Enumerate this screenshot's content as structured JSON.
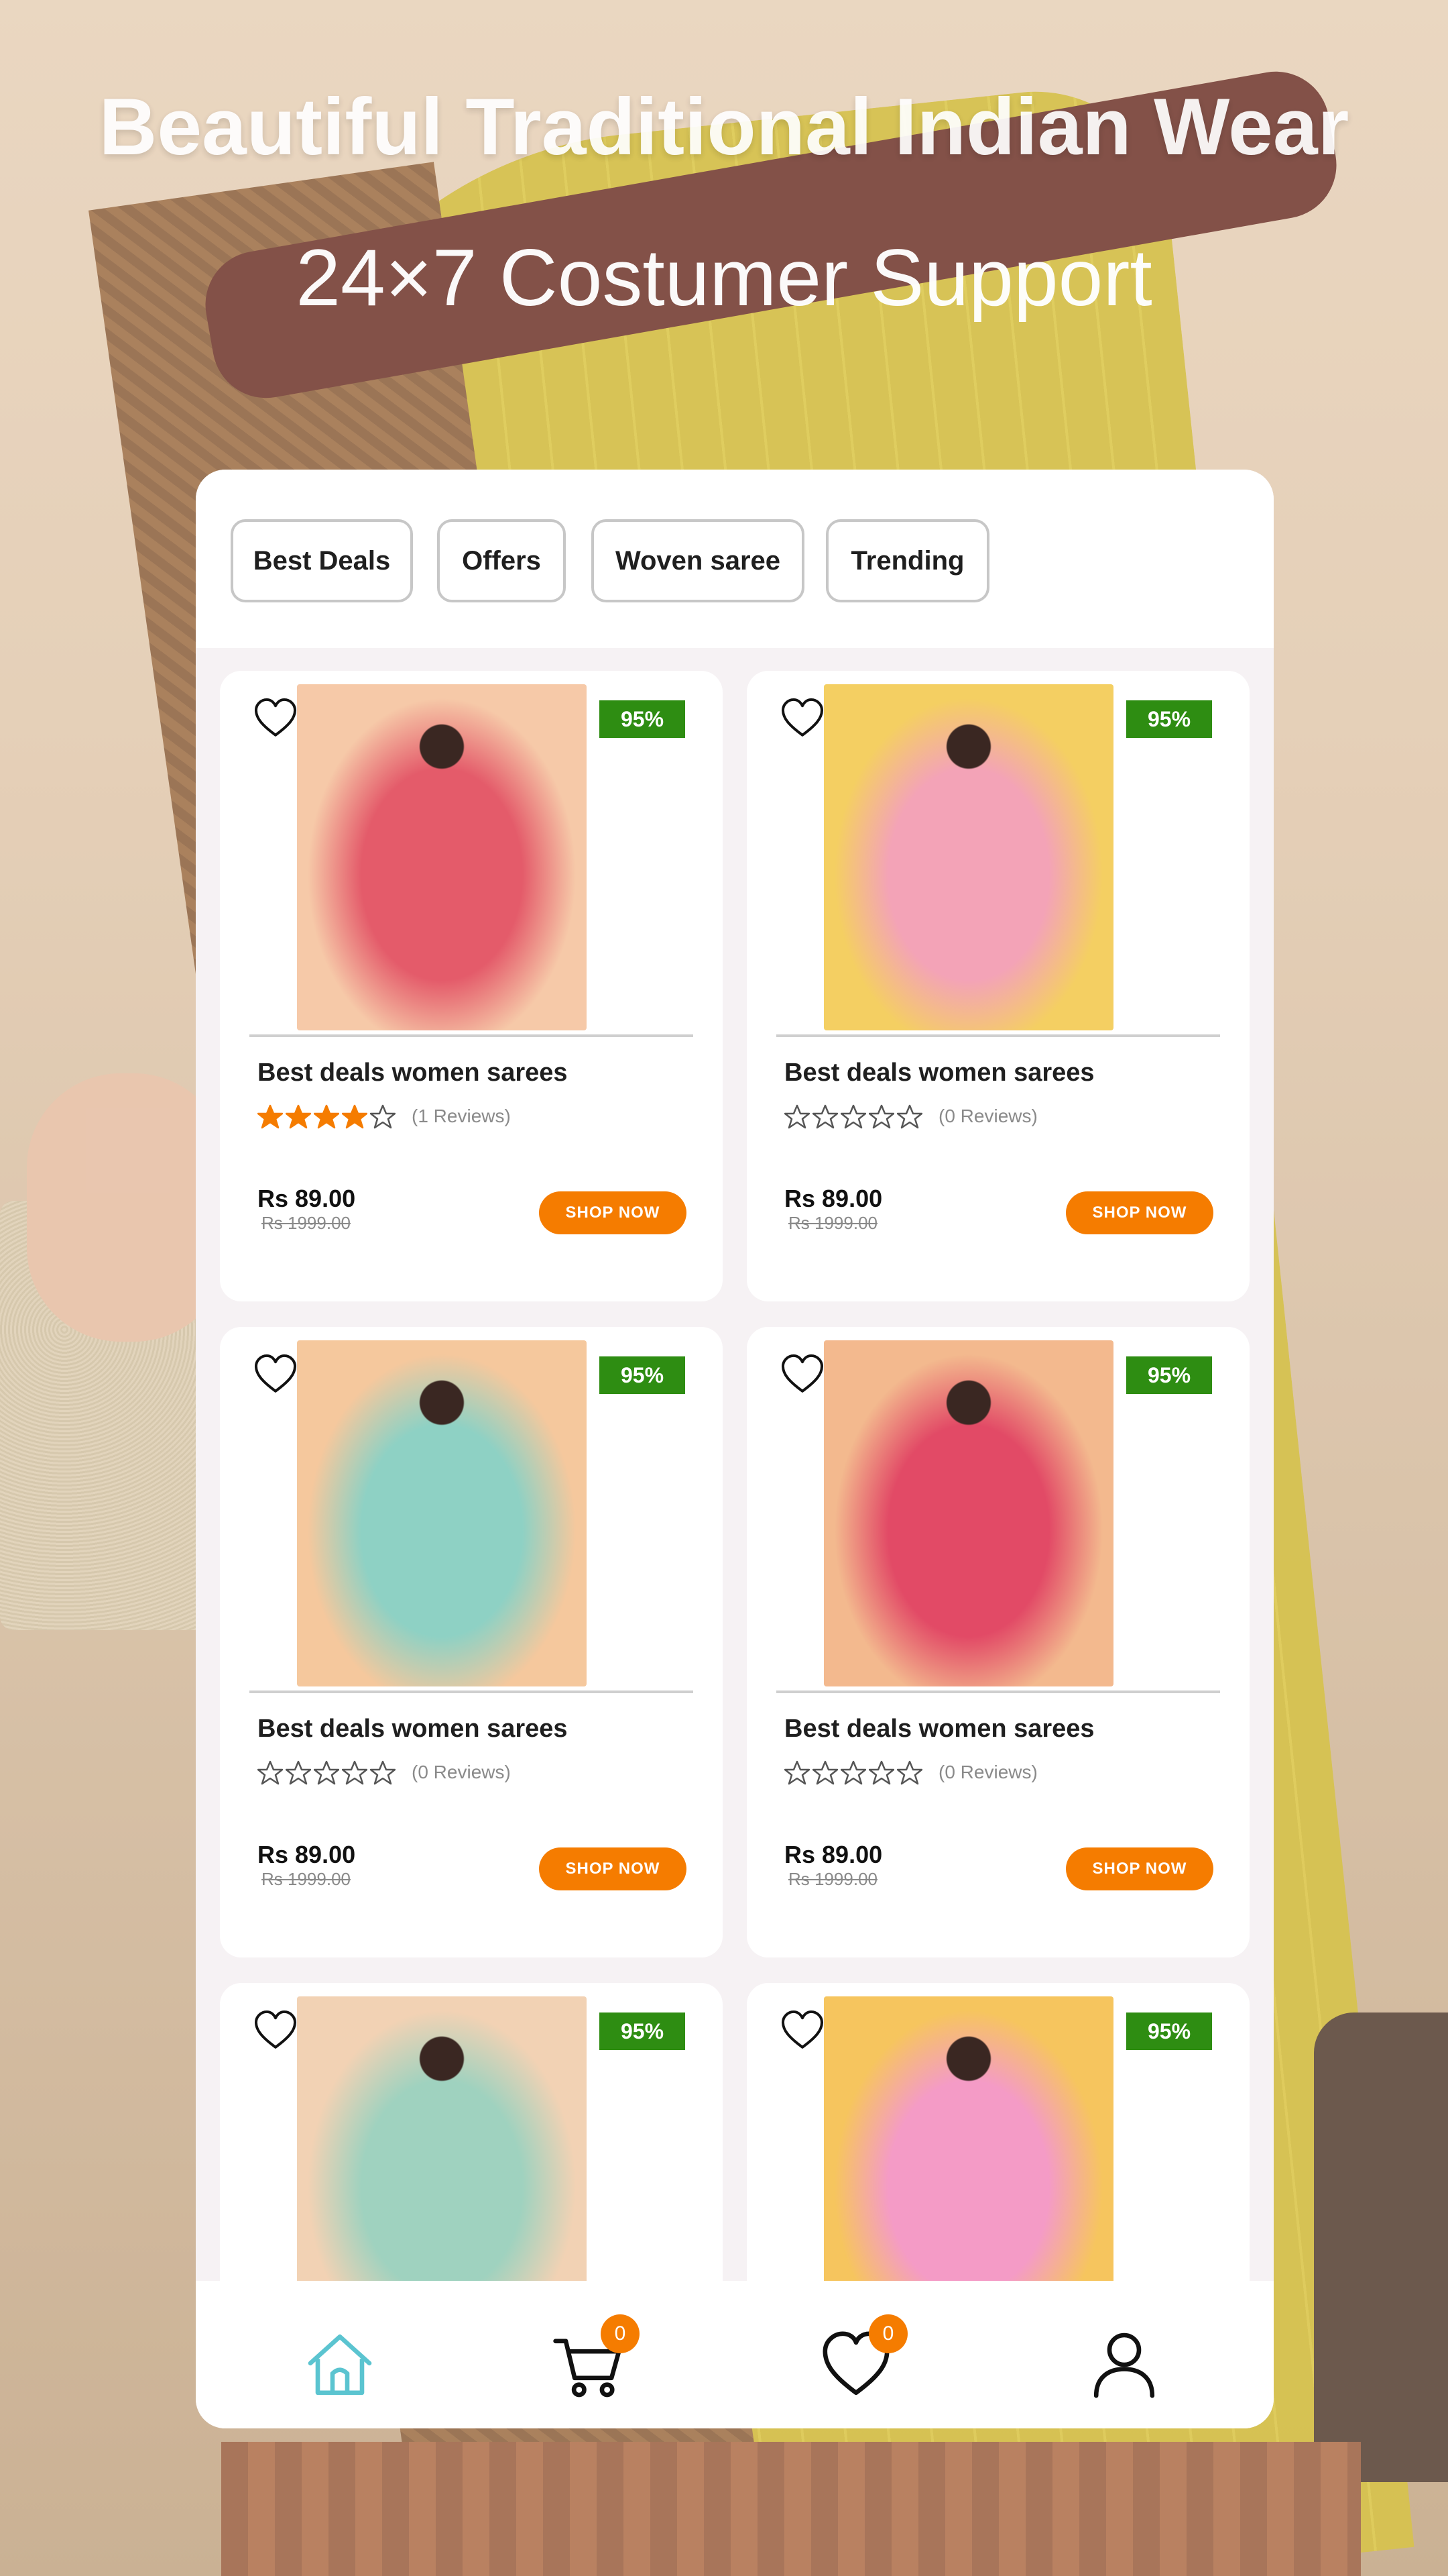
{
  "headline": "Beautiful Traditional Indian Wear",
  "subheadline": "24×7 Costumer Support",
  "filters": [
    "Best Deals",
    "Offers",
    "Woven saree",
    "Trending"
  ],
  "products": [
    {
      "title": "Best deals women sarees",
      "discount": "95%",
      "rating": 4,
      "reviews": "(1 Reviews)",
      "price": "Rs 89.00",
      "old_price": "Rs 1999.00",
      "cta": "SHOP NOW",
      "photo_colors": [
        "#f6c9a8",
        "#e45b6a",
        "#7bb3c9"
      ]
    },
    {
      "title": "Best deals women sarees",
      "discount": "95%",
      "rating": 0,
      "reviews": "(0 Reviews)",
      "price": "Rs 89.00",
      "old_price": "Rs 1999.00",
      "cta": "SHOP NOW",
      "photo_colors": [
        "#f4cf62",
        "#f3a3b7",
        "#f1e2c7"
      ]
    },
    {
      "title": "Best deals women sarees",
      "discount": "95%",
      "rating": 0,
      "reviews": "(0 Reviews)",
      "price": "Rs 89.00",
      "old_price": "Rs 1999.00",
      "cta": "SHOP NOW",
      "photo_colors": [
        "#f5c89d",
        "#8ed1c4",
        "#f28ab2"
      ]
    },
    {
      "title": "Best deals women sarees",
      "discount": "95%",
      "rating": 0,
      "reviews": "(0 Reviews)",
      "price": "Rs 89.00",
      "old_price": "Rs 1999.00",
      "cta": "SHOP NOW",
      "photo_colors": [
        "#f3b98e",
        "#e24a66",
        "#f59a48"
      ]
    },
    {
      "title": "",
      "discount": "95%",
      "photo_colors": [
        "#f2d2b4",
        "#9fd2bf",
        "#f07f62"
      ]
    },
    {
      "title": "",
      "discount": "95%",
      "photo_colors": [
        "#f6c55e",
        "#f49bc6",
        "#8ccfe5"
      ]
    }
  ],
  "nav": {
    "items": [
      "home-icon",
      "cart-icon",
      "heart-icon",
      "user-icon"
    ],
    "cart_count": "0",
    "wishlist_count": "0",
    "active_color": "#5bc4d0",
    "inactive_color": "#111111"
  },
  "colors": {
    "accent": "#f57c00",
    "badge": "#2e8d12",
    "star": "#f57c00"
  }
}
